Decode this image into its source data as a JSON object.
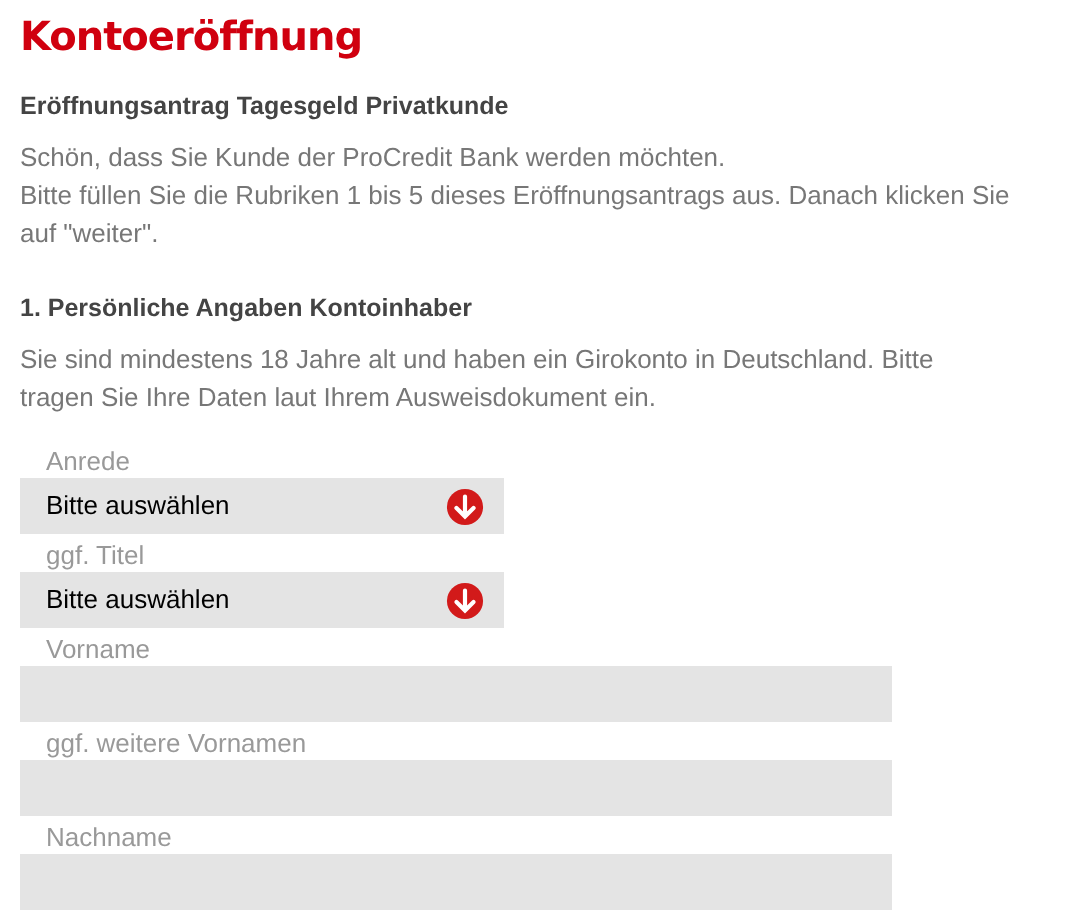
{
  "title": "Kontoeröffnung",
  "intro": {
    "heading": "Eröffnungsantrag Tagesgeld Privatkunde",
    "lines": [
      "Schön, dass Sie Kunde der ProCredit Bank werden möchten.",
      "Bitte füllen Sie die Rubriken 1 bis 5 dieses Eröffnungsantrags aus. Danach klicken Sie auf \"weiter\"."
    ]
  },
  "section": {
    "heading": "1. Persönliche Angaben Kontoinhaber",
    "text": "Sie sind mindestens 18 Jahre alt und haben ein Girokonto in Deutschland. Bitte tragen Sie Ihre Daten laut Ihrem Ausweisdokument ein."
  },
  "fields": [
    {
      "kind": "select",
      "label": "Anrede",
      "value": "Bitte auswählen"
    },
    {
      "kind": "select",
      "label": "ggf. Titel",
      "value": "Bitte auswählen"
    },
    {
      "kind": "text",
      "label": "Vorname"
    },
    {
      "kind": "text",
      "label": "ggf. weitere Vornamen"
    },
    {
      "kind": "text",
      "label": "Nachname"
    }
  ]
}
